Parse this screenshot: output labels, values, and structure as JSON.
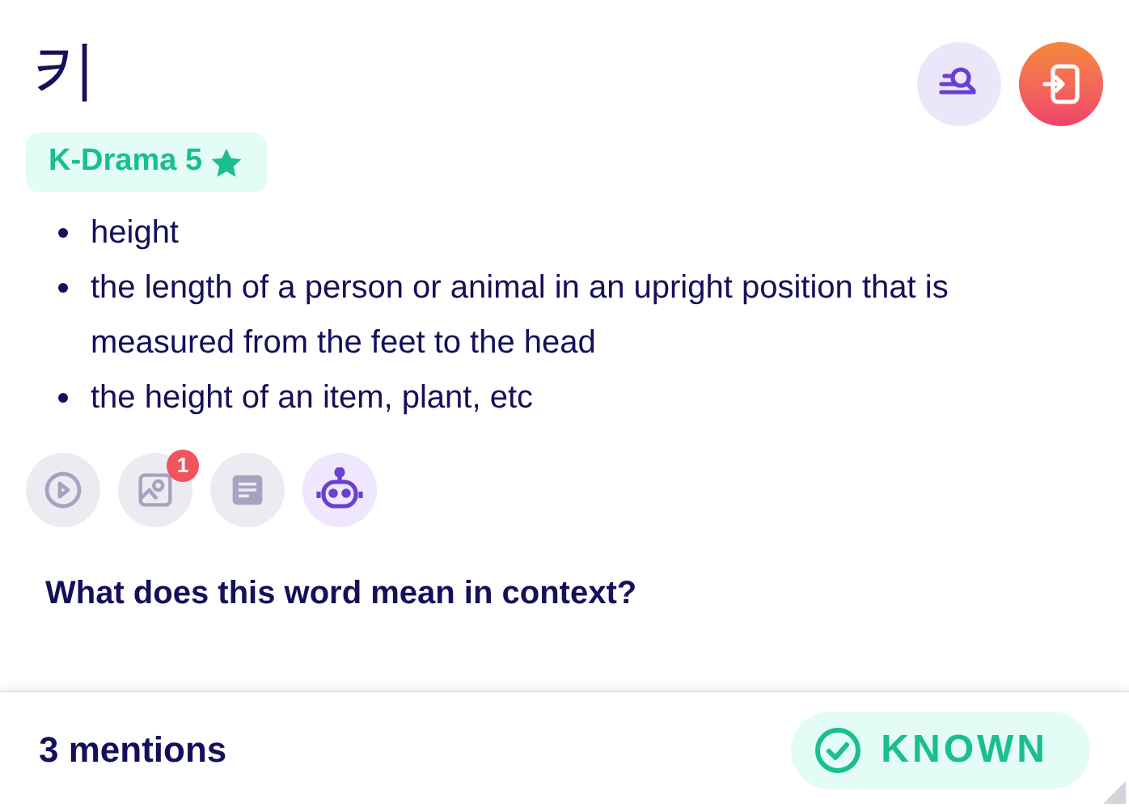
{
  "word": "키",
  "tag": {
    "label": "K-Drama 5",
    "starred": true
  },
  "definitions": [
    "height",
    "the length of a person or animal in an upright position that is measured from the feet to the head",
    "the height of an item, plant, etc"
  ],
  "tools": [
    {
      "kind": "play",
      "active": false
    },
    {
      "kind": "image",
      "active": false,
      "badge": "1"
    },
    {
      "kind": "text",
      "active": false
    },
    {
      "kind": "robot",
      "active": true
    }
  ],
  "context_heading": "What does this word mean in context?",
  "footer": {
    "mentions": "3 mentions",
    "known_button": "KNOWN"
  }
}
